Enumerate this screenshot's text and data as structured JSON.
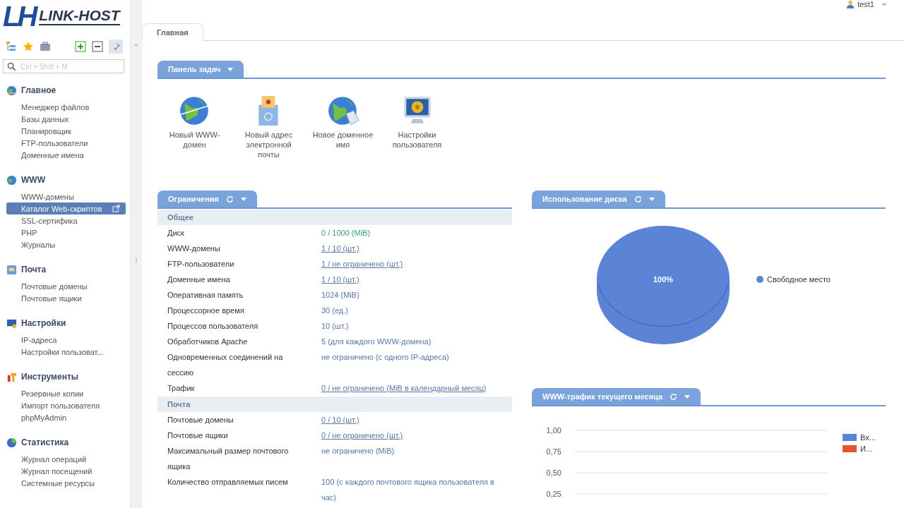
{
  "logo": {
    "mark": "LH",
    "name": "LINK-HOST"
  },
  "user": {
    "name": "test1"
  },
  "sidebar": {
    "search": {
      "placeholder": "Ctrl + Shift + M"
    },
    "groups": [
      {
        "title": "Главное",
        "items": [
          {
            "label": "Менеджер файлов",
            "selected": false
          },
          {
            "label": "Базы данных",
            "selected": false
          },
          {
            "label": "Планировщик",
            "selected": false
          },
          {
            "label": "FTP-пользователи",
            "selected": false
          },
          {
            "label": "Доменные имена",
            "selected": false
          }
        ]
      },
      {
        "title": "WWW",
        "items": [
          {
            "label": "WWW-домены",
            "selected": false
          },
          {
            "label": "Каталог Web-скриптов",
            "selected": true
          },
          {
            "label": "SSL-сертифика",
            "selected": false
          },
          {
            "label": "PHP",
            "selected": false
          },
          {
            "label": "Журналы",
            "selected": false
          }
        ]
      },
      {
        "title": "Почта",
        "items": [
          {
            "label": "Почтовые домены",
            "selected": false
          },
          {
            "label": "Почтовые ящики",
            "selected": false
          }
        ]
      },
      {
        "title": "Настройки",
        "items": [
          {
            "label": "IP-адреса",
            "selected": false
          },
          {
            "label": "Настройки пользоват...",
            "selected": false
          }
        ]
      },
      {
        "title": "Инструменты",
        "items": [
          {
            "label": "Резервные копии",
            "selected": false
          },
          {
            "label": "Импорт пользователя",
            "selected": false
          },
          {
            "label": "phpMyAdmin",
            "selected": false
          }
        ]
      },
      {
        "title": "Статистика",
        "items": [
          {
            "label": "Журнал операций",
            "selected": false
          },
          {
            "label": "Журнал посещений",
            "selected": false
          },
          {
            "label": "Системные ресурсы",
            "selected": false
          }
        ]
      }
    ]
  },
  "tabs": [
    {
      "label": "Главная",
      "selected": true
    }
  ],
  "task_panel": {
    "title": "Панель задач",
    "items": [
      {
        "label": "Новый WWW-домен"
      },
      {
        "label": "Новый адрес электронной почты"
      },
      {
        "label": "Новое доменное имя"
      },
      {
        "label": "Настройки пользователя"
      }
    ]
  },
  "limits": {
    "title": "Ограничения",
    "rows": [
      {
        "kind": "section",
        "label": "Общее"
      },
      {
        "kind": "row",
        "label": "Диск",
        "value": "0 / 1000 (MiB)",
        "link": false,
        "ok": true
      },
      {
        "kind": "row",
        "label": "WWW-домены",
        "value": "1 / 10 (шт.)",
        "link": true,
        "ok": false
      },
      {
        "kind": "row",
        "label": "FTP-пользователи",
        "value": "1 / не ограничено (шт.)",
        "link": true,
        "ok": false
      },
      {
        "kind": "row",
        "label": "Доменные имена",
        "value": "1 / 10 (шт.)",
        "link": true,
        "ok": false
      },
      {
        "kind": "row",
        "label": "Оперативная память",
        "value": "1024 (MiB)",
        "link": false,
        "ok": false
      },
      {
        "kind": "row",
        "label": "Процессорное время",
        "value": "30 (ед.)",
        "link": false,
        "ok": false
      },
      {
        "kind": "row",
        "label": "Процессов пользователя",
        "value": "10 (шт.)",
        "link": false,
        "ok": false
      },
      {
        "kind": "row",
        "label": "Обработчиков Apache",
        "value": "5 (для каждого WWW-домена)",
        "link": false,
        "ok": false
      },
      {
        "kind": "row",
        "label": "Одновременных соединений на сессию",
        "value": "не ограничено (с одного IP-адреса)",
        "link": false,
        "ok": false
      },
      {
        "kind": "row",
        "label": "Трафик",
        "value": "0 / не ограничено (MiB в календарный месяц)",
        "link": true,
        "ok": false
      },
      {
        "kind": "section",
        "label": "Почта"
      },
      {
        "kind": "row",
        "label": "Почтовые домены",
        "value": "0 / 10 (шт.)",
        "link": true,
        "ok": false
      },
      {
        "kind": "row",
        "label": "Почтовые ящики",
        "value": "0 / не ограничено (шт.)",
        "link": true,
        "ok": false
      },
      {
        "kind": "row",
        "label": "Максимальный размер почтового ящика",
        "value": "не ограничено (MiB)",
        "link": false,
        "ok": false
      },
      {
        "kind": "row",
        "label": "Количество отправляемых писем",
        "value": "100 (с каждого почтового ящика пользователя в час)",
        "link": false,
        "ok": false
      }
    ]
  },
  "disk_usage": {
    "title": "Использование диска",
    "chart_data": {
      "type": "pie",
      "categories": [
        "Свободное место"
      ],
      "series": [
        {
          "color": "#5b84d6",
          "values": [
            100
          ]
        }
      ],
      "value_labels": [
        "100%"
      ]
    }
  },
  "traffic": {
    "title": "WWW-трафик текущего месяца",
    "chart_data": {
      "type": "line",
      "ylim": [
        0.25,
        1
      ],
      "grid": true,
      "yticks": [
        {
          "value": 1,
          "label": "1,00"
        },
        {
          "value": 0.75,
          "label": "0,75"
        },
        {
          "value": 0.5,
          "label": "0,50"
        },
        {
          "value": 0.25,
          "label": "0,25"
        }
      ],
      "series": [
        {
          "name": "Вх...",
          "color": "#5b84d6"
        },
        {
          "name": "И...",
          "color": "#e5532f"
        }
      ]
    }
  }
}
